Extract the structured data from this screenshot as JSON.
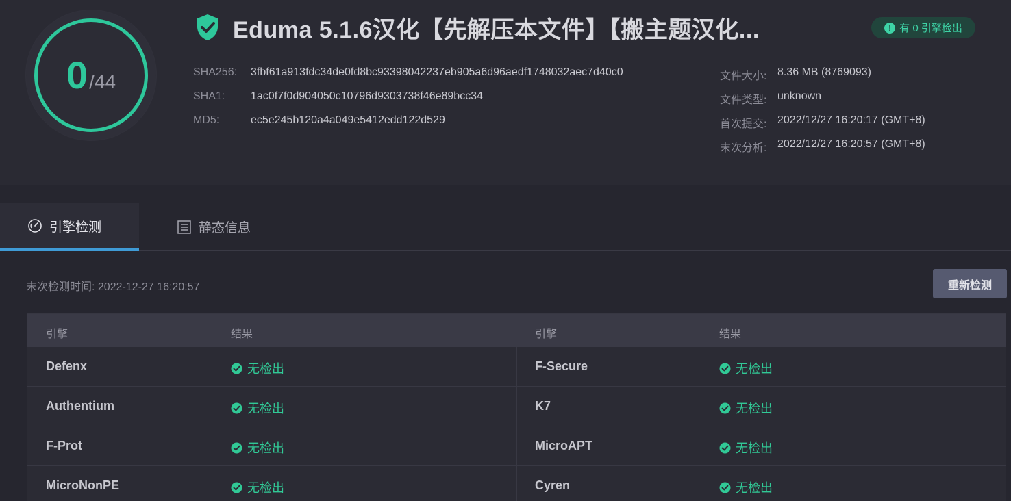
{
  "score": {
    "detected": "0",
    "total": "/44"
  },
  "title": "Eduma 5.1.6汉化【先解压本文件】【搬主题汉化...",
  "badge": {
    "icon": "!",
    "text": "有 0 引擎检出"
  },
  "hashes": [
    {
      "label": "SHA256:",
      "value": "3fbf61a913fdc34de0fd8bc93398042237eb905a6d96aedf1748032aec7d40c0"
    },
    {
      "label": "SHA1:",
      "value": "1ac0f7f0d904050c10796d9303738f46e89bcc34"
    },
    {
      "label": "MD5:",
      "value": "ec5e245b120a4a049e5412edd122d529"
    }
  ],
  "meta": [
    {
      "label": "文件大小:",
      "value": "8.36 MB (8769093)"
    },
    {
      "label": "文件类型:",
      "value": "unknown"
    },
    {
      "label": "首次提交:",
      "value": "2022/12/27 16:20:17 (GMT+8)"
    },
    {
      "label": "末次分析:",
      "value": "2022/12/27 16:20:57 (GMT+8)"
    }
  ],
  "tabs": [
    {
      "label": "引擎检测",
      "icon": "gauge-icon",
      "active": true
    },
    {
      "label": "静态信息",
      "icon": "document-list-icon",
      "active": false
    }
  ],
  "last_check": "末次检测时间: 2022-12-27 16:20:57",
  "rescan_label": "重新检测",
  "table": {
    "headers": [
      "引擎",
      "结果",
      "引擎",
      "结果"
    ],
    "rows": [
      {
        "left_engine": "Defenx",
        "left_result": "无检出",
        "right_engine": "F-Secure",
        "right_result": "无检出"
      },
      {
        "left_engine": "Authentium",
        "left_result": "无检出",
        "right_engine": "K7",
        "right_result": "无检出"
      },
      {
        "left_engine": "F-Prot",
        "left_result": "无检出",
        "right_engine": "MicroAPT",
        "right_result": "无检出"
      },
      {
        "left_engine": "MicroNonPE",
        "left_result": "无检出",
        "right_engine": "Cyren",
        "right_result": "无检出"
      }
    ]
  },
  "colors": {
    "accent_green": "#2ec79b",
    "tab_underline": "#3f9bd6",
    "background": "#26262f"
  }
}
